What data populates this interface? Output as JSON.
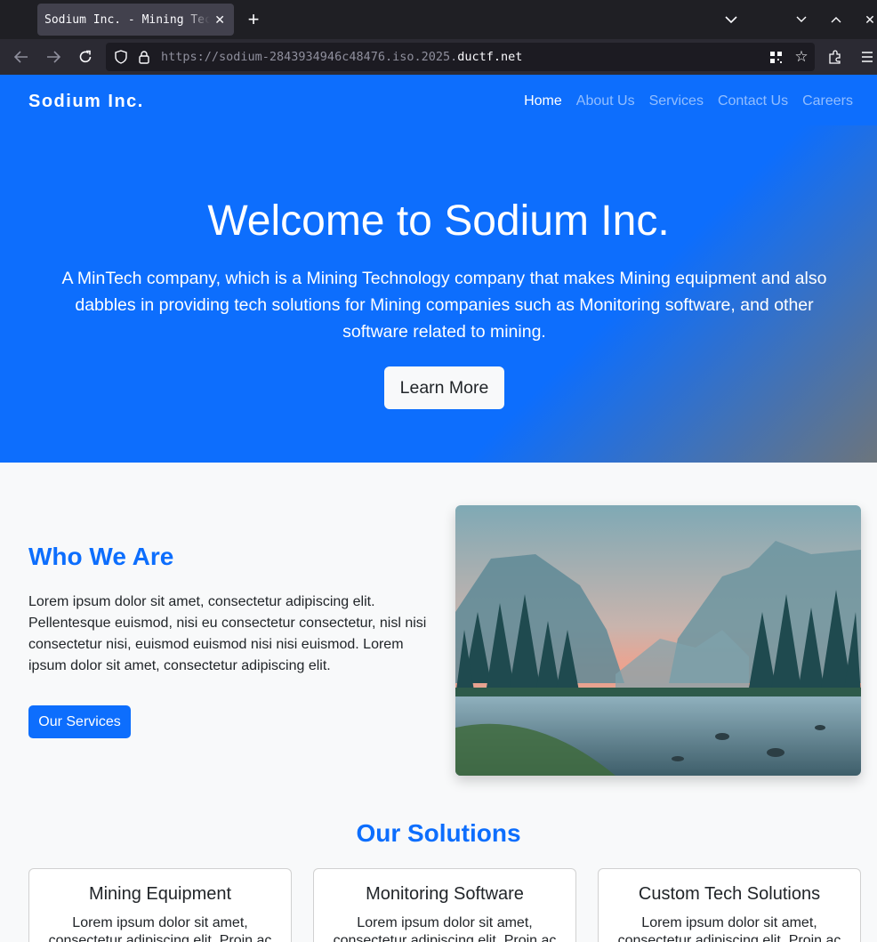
{
  "browser": {
    "tab_title": "Sodium Inc. - Mining Technology",
    "url_prefix": "https://sodium-2843934946c48476.iso.2025.",
    "url_domain": "ductf.net"
  },
  "site": {
    "brand": "Sodium Inc.",
    "nav": [
      "Home",
      "About Us",
      "Services",
      "Contact Us",
      "Careers"
    ],
    "active_nav": "Home"
  },
  "hero": {
    "title": "Welcome to Sodium Inc.",
    "text": "A MinTech company, which is a Mining Technology company that makes Mining equipment and also dabbles in providing tech solutions for Mining companies such as Monitoring software, and other software related to mining.",
    "button": "Learn More"
  },
  "about": {
    "title": "Who We Are",
    "text": "Lorem ipsum dolor sit amet, consectetur adipiscing elit. Pellentesque euismod, nisi eu consectetur consectetur, nisl nisi consectetur nisi, euismod euismod nisi nisi euismod. Lorem ipsum dolor sit amet, consectetur adipiscing elit.",
    "button": "Our Services"
  },
  "solutions": {
    "title": "Our Solutions",
    "cards": [
      {
        "title": "Mining Equipment",
        "text": "Lorem ipsum dolor sit amet, consectetur adipiscing elit. Proin ac"
      },
      {
        "title": "Monitoring Software",
        "text": "Lorem ipsum dolor sit amet, consectetur adipiscing elit. Proin ac"
      },
      {
        "title": "Custom Tech Solutions",
        "text": "Lorem ipsum dolor sit amet, consectetur adipiscing elit. Proin ac"
      }
    ]
  },
  "colors": {
    "primary": "#0d6efd",
    "chrome_dark": "#1f1f24",
    "chrome_bar": "#2b2a33"
  }
}
